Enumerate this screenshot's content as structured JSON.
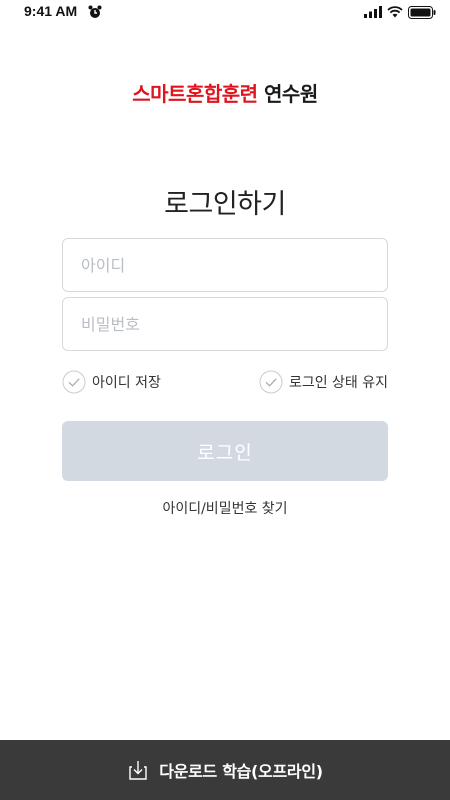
{
  "status": {
    "time": "9:41 AM",
    "icons": [
      "alarm-icon",
      "signal-icon",
      "wifi-icon",
      "battery-icon"
    ]
  },
  "brand": {
    "red_part": "스마트혼합훈련",
    "dark_part": "연수원",
    "red_color": "#e0141e"
  },
  "login": {
    "title": "로그인하기",
    "id_placeholder": "아이디",
    "password_placeholder": "비밀번호",
    "remember_id_label": "아이디 저장",
    "keep_login_label": "로그인 상태 유지",
    "submit_label": "로그인",
    "find_label": "아이디/비밀번호 찾기"
  },
  "bottom_bar": {
    "label": "다운로드 학습(오프라인)",
    "icon": "download-icon"
  },
  "colors": {
    "button_disabled": "#d3d9e1",
    "bottom_bar": "#3a3a3a",
    "field_border": "#d5d9de"
  }
}
